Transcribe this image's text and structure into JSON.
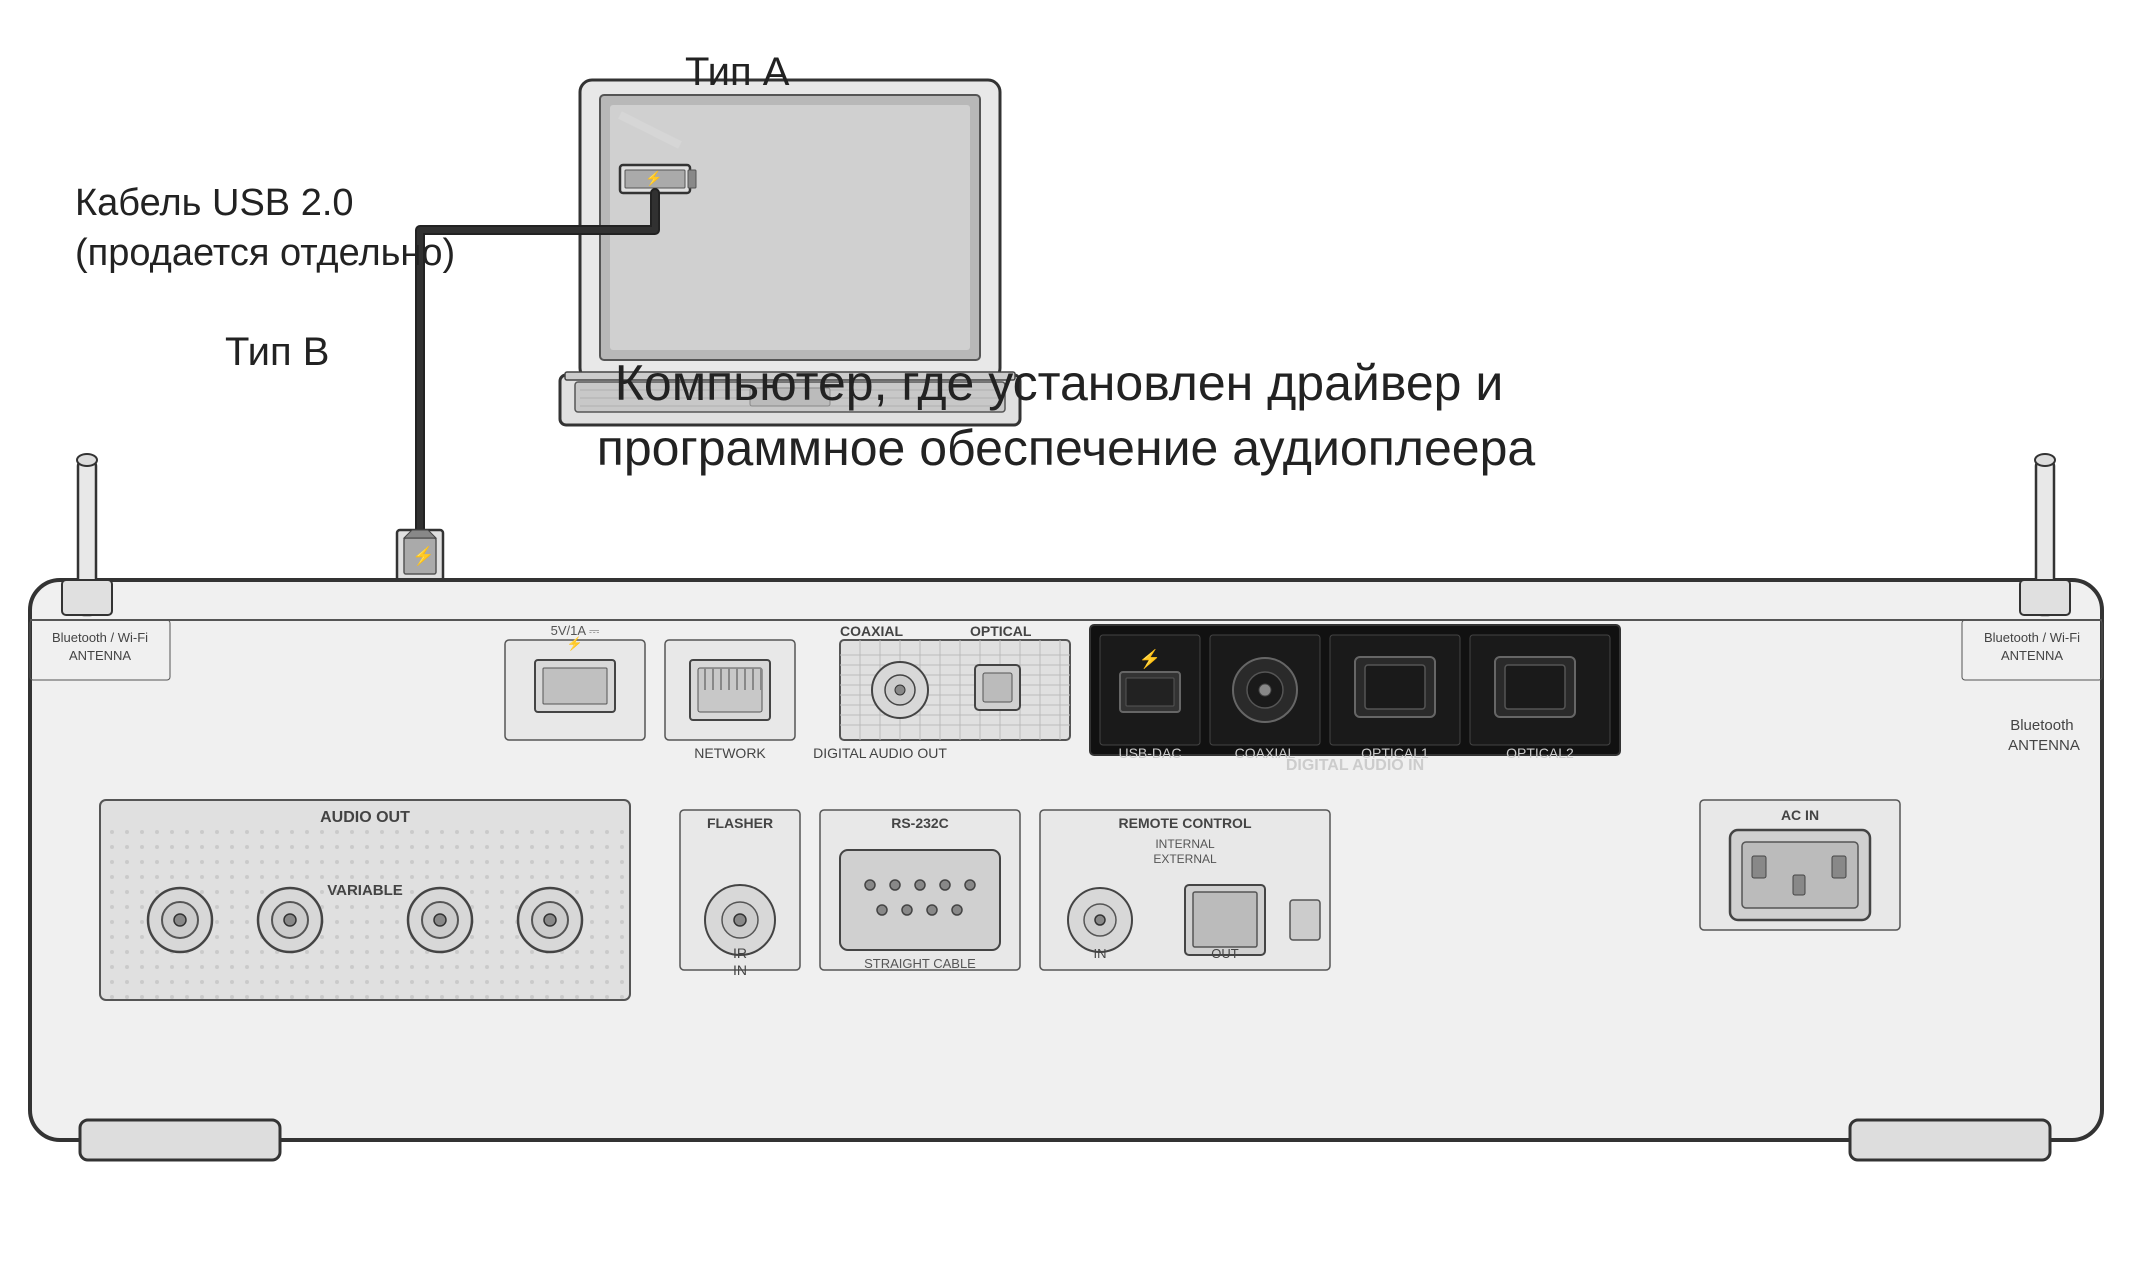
{
  "labels": {
    "usb_cable": "Кабель USB 2.0\n(продается отдельно)",
    "type_a": "Тип А",
    "type_b": "Тип В",
    "computer_description": "Компьютер, где установлен драйвер и\nпрограммное обеспечение аудиоплеера",
    "bluetooth_antenna_left": "Bluetooth / Wi-Fi\nANTENNA",
    "bluetooth_antenna_right": "Bluetooth / Wi-Fi\nANTENNA",
    "audio_out": "AUDIO OUT",
    "variable": "VARIABLE",
    "digital_audio_out": "DIGITAL AUDIO OUT",
    "digital_audio_in": "DIGITAL AUDIO IN",
    "coaxial_out": "COAXIAL",
    "optical_out": "OPTICAL",
    "usb_dac": "USB-DAC",
    "coaxial_in": "COAXIAL",
    "optical1_in": "OPTICAL1",
    "optical2_in": "OPTICAL2",
    "network": "NETWORK",
    "power_usb": "5V/1A",
    "flasher": "FLASHER",
    "ir_in": "IR\nIN",
    "rs232c": "RS-232C",
    "straight_cable": "STRAIGHT CABLE",
    "remote_control": "REMOTE CONTROL",
    "internal": "INTERNAL",
    "external": "EXTERNAL",
    "rc_in": "IN",
    "rc_out": "OUT",
    "ac_in": "AC IN"
  },
  "colors": {
    "outline": "#333333",
    "fill_light": "#f0f0f0",
    "fill_dark": "#cccccc",
    "background": "#ffffff",
    "device_body": "#e8e8e8",
    "black_bar": "#111111"
  }
}
